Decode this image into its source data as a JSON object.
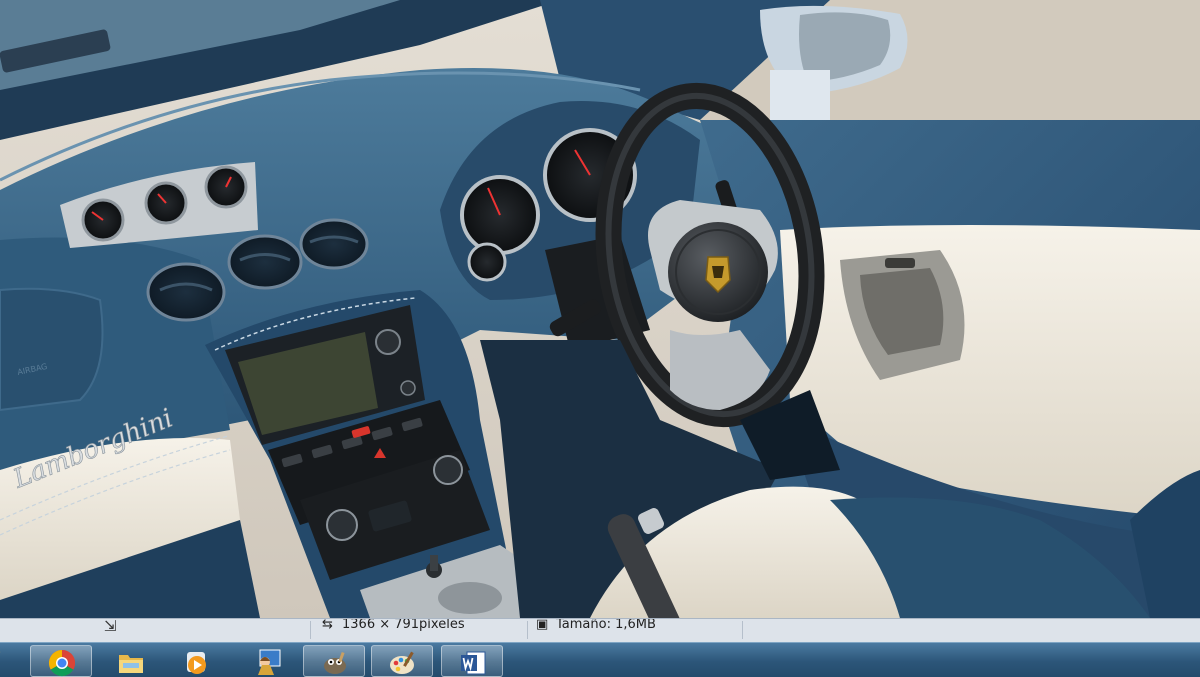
{
  "status_bar": {
    "dimensions": "1366 × 791píxeles",
    "size": "Tamaño: 1,6MB"
  },
  "photo": {
    "badge_text": "Lamborghini",
    "airbag_text": "AIRBAG"
  },
  "taskbar": {
    "items": [
      "internet-explorer-icon",
      "chrome-icon",
      "explorer-icon",
      "media-player-icon",
      "photo-app-icon",
      "gimp-icon",
      "paint-icon",
      "word-icon"
    ]
  },
  "colors": {
    "dash_blue": "#2f5b7c",
    "cream_leather": "#ece7db",
    "taskbar": "#2c5679"
  }
}
